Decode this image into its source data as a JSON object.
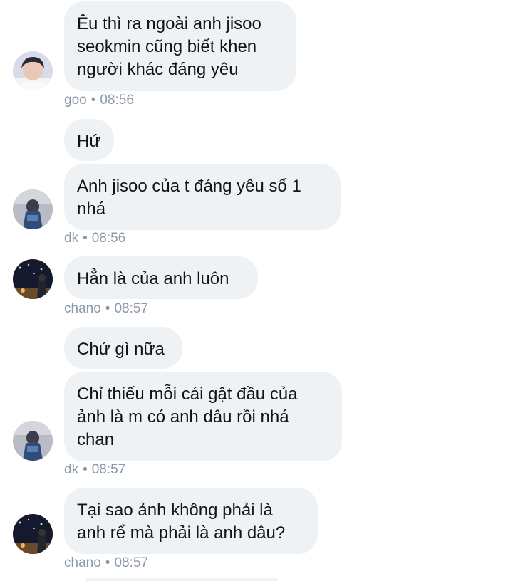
{
  "messages": [
    {
      "lines": [
        "Êu thì ra ngoài anh jisoo",
        "seokmin cũng biết khen",
        "người khác đáng yêu"
      ]
    },
    {
      "lines": [
        "Hứ"
      ]
    },
    {
      "lines": [
        "Anh jisoo của t đáng yêu số 1",
        "nhá"
      ]
    },
    {
      "lines": [
        "Hẳn là của anh luôn"
      ]
    },
    {
      "lines": [
        "Chứ gì nữa"
      ]
    },
    {
      "lines": [
        "Chỉ thiếu mỗi cái gật đầu của",
        "ảnh là m có anh dâu rồi nhá",
        "chan"
      ]
    },
    {
      "lines": [
        "Tại sao ảnh không phải là",
        "anh rể mà phải là anh dâu?"
      ]
    }
  ],
  "meta": [
    {
      "name": "goo",
      "time": "08:56"
    },
    {
      "name": "dk",
      "time": "08:56"
    },
    {
      "name": "chano",
      "time": "08:57"
    },
    {
      "name": "dk",
      "time": "08:57"
    },
    {
      "name": "chano",
      "time": "08:57"
    }
  ],
  "separator": "•",
  "colors": {
    "bubble": "#eff2f5",
    "text": "#0f1419",
    "meta": "#8b98a5"
  }
}
